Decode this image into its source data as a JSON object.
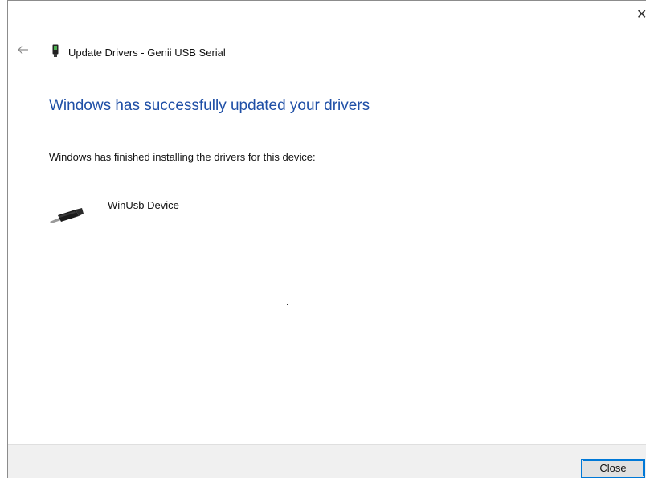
{
  "window": {
    "close_glyph": "✕",
    "icons": {
      "back": "back-arrow-icon",
      "title_device": "usb-device-icon",
      "device": "usb-cable-icon"
    }
  },
  "header": {
    "title": "Update Drivers - Genii USB Serial"
  },
  "main": {
    "headline": "Windows has successfully updated your drivers",
    "message": "Windows has finished installing the drivers for this device:",
    "device_name": "WinUsb Device"
  },
  "footer": {
    "close_label": "Close"
  },
  "colors": {
    "headline": "#1f4fa6",
    "button_border": "#0078d7",
    "footer_bg": "#f0f0f0"
  }
}
